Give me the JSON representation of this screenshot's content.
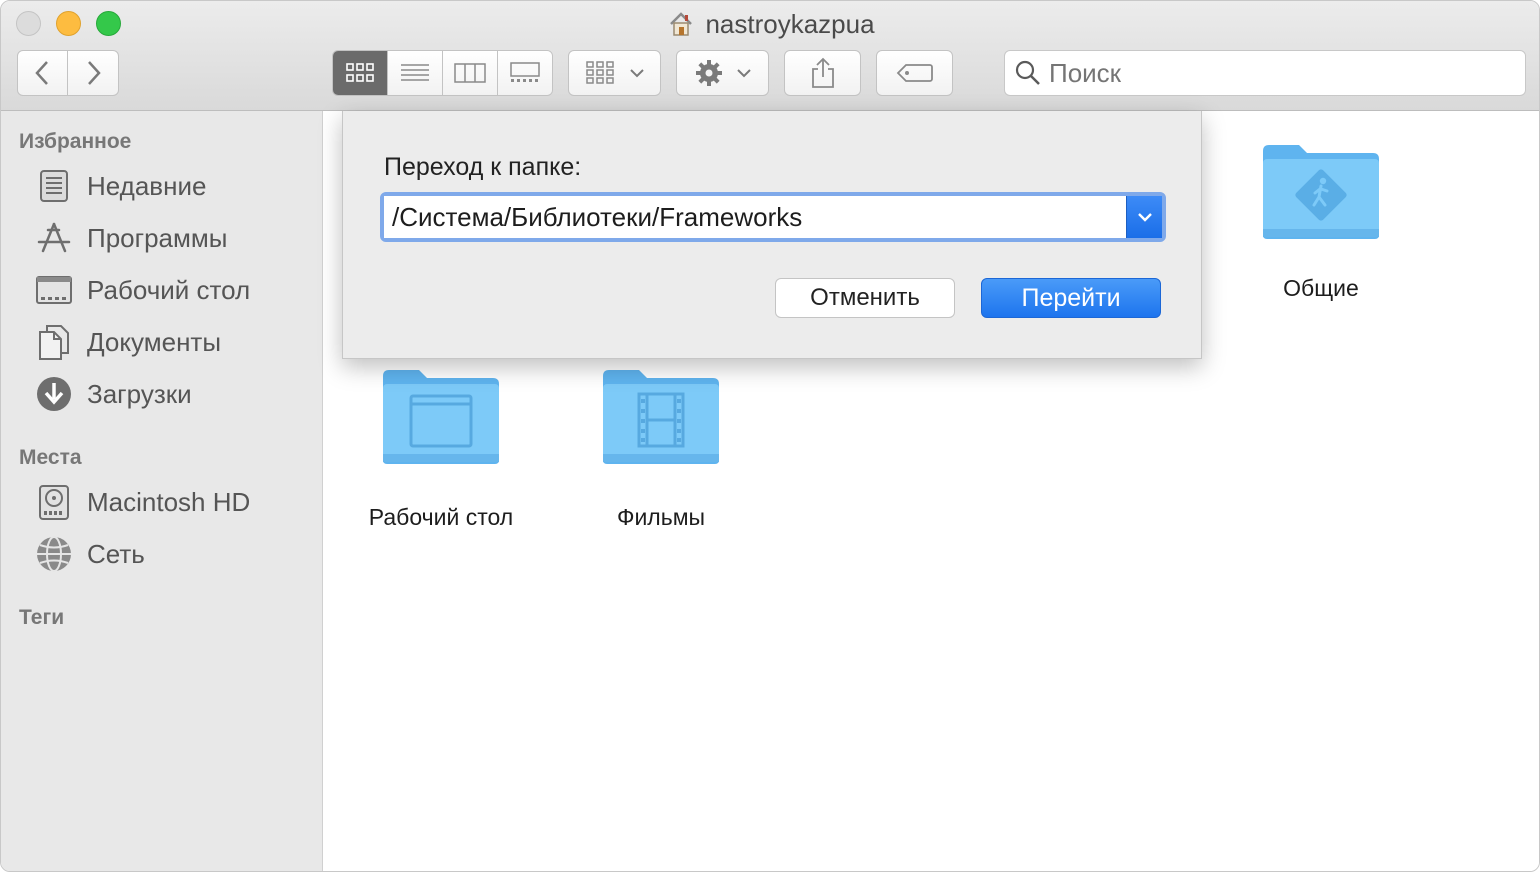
{
  "window": {
    "title": "nastroykazpua"
  },
  "toolbar": {
    "view_modes": [
      "icons",
      "list",
      "columns",
      "gallery"
    ],
    "active_view": "icons",
    "search_placeholder": "Поиск"
  },
  "sidebar": {
    "favorites_header": "Избранное",
    "favorites": [
      {
        "label": "Недавние",
        "icon": "recents-icon"
      },
      {
        "label": "Программы",
        "icon": "applications-icon"
      },
      {
        "label": "Рабочий стол",
        "icon": "desktop-icon"
      },
      {
        "label": "Документы",
        "icon": "documents-icon"
      },
      {
        "label": "Загрузки",
        "icon": "downloads-icon"
      }
    ],
    "places_header": "Места",
    "places": [
      {
        "label": "Macintosh HD",
        "icon": "hard-drive-icon"
      },
      {
        "label": "Сеть",
        "icon": "network-icon"
      }
    ],
    "tags_header": "Теги"
  },
  "content": {
    "folders": [
      {
        "label": "Общие",
        "icon": "public-folder-icon"
      },
      {
        "label": "Рабочий стол",
        "icon": "desktop-folder-icon"
      },
      {
        "label": "Фильмы",
        "icon": "movies-folder-icon"
      }
    ]
  },
  "dialog": {
    "label": "Переход к папке:",
    "path_value": "/Система/Библиотеки/Frameworks",
    "cancel_label": "Отменить",
    "go_label": "Перейти"
  },
  "colors": {
    "accent": "#1d74ee",
    "folder": "#6cc0f5",
    "focus_ring": "#7fa9ea"
  }
}
